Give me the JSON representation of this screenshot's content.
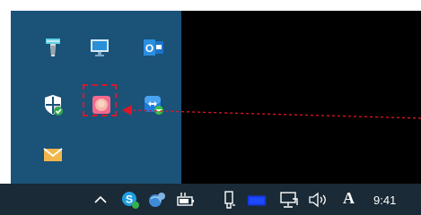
{
  "overflow_panel": {
    "icons": [
      {
        "name": "pen-tablet-icon"
      },
      {
        "name": "monitor-icon"
      },
      {
        "name": "outlook-icon",
        "label": "O"
      },
      {
        "name": "defender-shield-icon"
      },
      {
        "name": "pink-app-icon"
      },
      {
        "name": "teamviewer-icon"
      },
      {
        "name": "mail-icon"
      }
    ],
    "highlight_color": "#e0152a"
  },
  "taskbar": {
    "show_hidden_icons": "^",
    "ime_label": "A",
    "clock": "9:41"
  }
}
